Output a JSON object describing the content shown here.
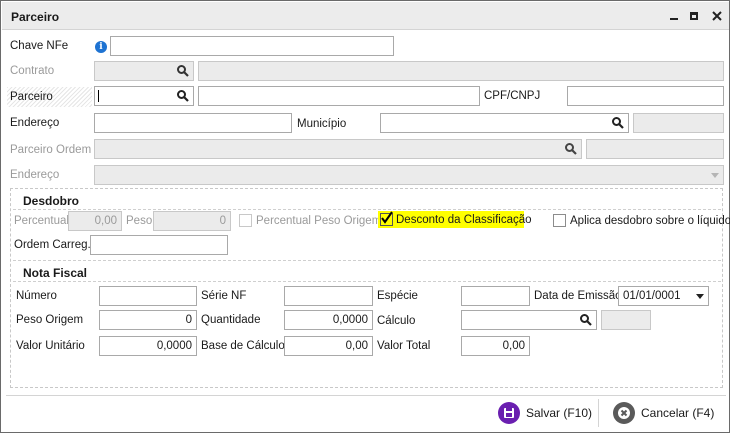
{
  "window": {
    "title": "Parceiro",
    "minimize_glyph": "▁",
    "maximize_glyph": "□",
    "close_glyph": "✕"
  },
  "form": {
    "chave_nfe": {
      "label": "Chave NFe",
      "value": ""
    },
    "contrato": {
      "label": "Contrato",
      "value": "",
      "description": ""
    },
    "parceiro": {
      "label": "Parceiro",
      "value": "",
      "description": ""
    },
    "cpf_cnpj": {
      "label": "CPF/CNPJ",
      "value": ""
    },
    "endereco": {
      "label": "Endereço",
      "value": ""
    },
    "municipio": {
      "label": "Município",
      "value": "",
      "uf": ""
    },
    "parceiro_ordem": {
      "label": "Parceiro Ordem",
      "value": "",
      "description": ""
    },
    "endereco_ordem": {
      "label": "Endereço",
      "value": ""
    }
  },
  "desdobro": {
    "title": "Desdobro",
    "percentual_label": "Percentual",
    "percentual_value": "0,00",
    "peso_label": "Peso",
    "peso_value": "0",
    "percentual_peso_origem_label": "Percentual Peso Origem",
    "desconto_classificacao_label": "Desconto da Classificação",
    "desconto_classificacao_checked": true,
    "aplica_desdobro_label": "Aplica desdobro sobre o líquido",
    "ordem_carreg_label": "Ordem Carreg.",
    "ordem_carreg_value": ""
  },
  "nota_fiscal": {
    "title": "Nota Fiscal",
    "numero_label": "Número",
    "numero_value": "",
    "serie_nf_label": "Série NF",
    "serie_nf_value": "",
    "especie_label": "Espécie",
    "especie_value": "",
    "data_emissao_label": "Data de Emissão",
    "data_emissao_value": "01/01/0001",
    "peso_origem_label": "Peso Origem",
    "peso_origem_value": "0",
    "quantidade_label": "Quantidade",
    "quantidade_value": "0,0000",
    "calculo_label": "Cálculo",
    "calculo_value": "",
    "calculo_extra": "",
    "valor_unitario_label": "Valor Unitário",
    "valor_unitario_value": "0,0000",
    "base_calculo_label": "Base de Cálculo",
    "base_calculo_value": "0,00",
    "valor_total_label": "Valor Total",
    "valor_total_value": "0,00"
  },
  "footer": {
    "save_label": "Salvar (F10)",
    "cancel_label": "Cancelar (F4)"
  },
  "colors": {
    "save_icon": "#6a1fb0",
    "cancel_icon": "#5a5a5a",
    "highlight": "#ffff00",
    "info_icon": "#1e73d2"
  }
}
